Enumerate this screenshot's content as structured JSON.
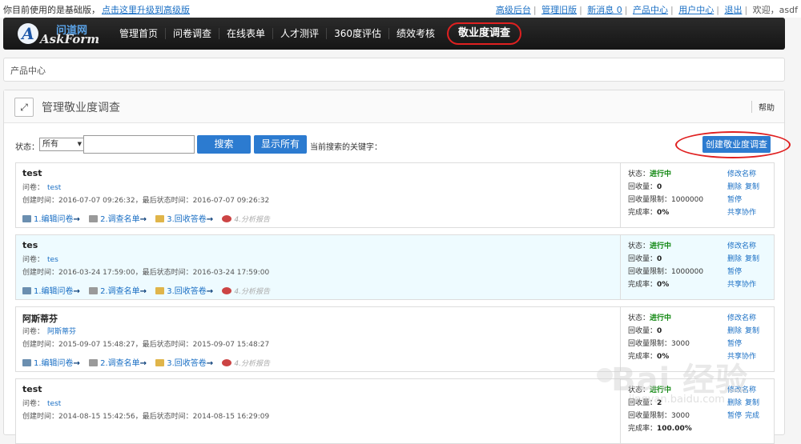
{
  "topbar": {
    "version_text": "你目前使用的是基础版，",
    "upgrade_link": "点击这里升级到高级版",
    "links": [
      "高级后台",
      "管理旧版",
      "新消息 0",
      "产品中心",
      "用户中心",
      "退出"
    ],
    "welcome": "欢迎，asdf"
  },
  "logo": {
    "cn": "问道网",
    "en": "AskForm",
    "letter": "A"
  },
  "nav": {
    "items": [
      "管理首页",
      "问卷调查",
      "在线表单",
      "人才测评",
      "360度评估",
      "绩效考核"
    ],
    "active": "敬业度调查"
  },
  "breadcrumb": "产品中心",
  "panel": {
    "title": "管理敬业度调查",
    "help": "帮助"
  },
  "filter": {
    "status_label": "状态：",
    "status_value": "所有",
    "search_btn": "搜索",
    "show_all_btn": "显示所有",
    "current_keyword_label": "当前搜索的关键字：",
    "create_btn": "创建敬业度调查"
  },
  "labels": {
    "questionnaire": "问卷：",
    "status": "状态：",
    "responses": "回收量：",
    "limit": "回收量限制：",
    "completion": "完成率：",
    "created": "创建时间：",
    "last_status": "，最后状态时间：",
    "step1": "1.编辑问卷",
    "step2": "2.调查名单",
    "step3": "3.回收答卷",
    "step4": "4.分析报告",
    "rename": "修改名称",
    "delete": "删除",
    "copy": "复制",
    "pause": "暂停",
    "share": "共享协作",
    "complete": "完成"
  },
  "surveys": [
    {
      "title": "test",
      "questionnaire": "test",
      "created": "2016-07-07 09:26:32",
      "last": "2016-07-07 09:26:32",
      "status": "进行中",
      "responses": "0",
      "limit": "1000000",
      "rate": "0%"
    },
    {
      "title": "tes",
      "questionnaire": "tes",
      "created": "2016-03-24 17:59:00",
      "last": "2016-03-24 17:59:00",
      "status": "进行中",
      "responses": "0",
      "limit": "1000000",
      "rate": "0%"
    },
    {
      "title": "阿斯蒂芬",
      "questionnaire": "阿斯蒂芬",
      "created": "2015-09-07 15:48:27",
      "last": "2015-09-07 15:48:27",
      "status": "进行中",
      "responses": "0",
      "limit": "3000",
      "rate": "0%"
    },
    {
      "title": "test",
      "questionnaire": "test",
      "created": "2014-08-15 15:42:56",
      "last": "2014-08-15 16:29:09",
      "status": "进行中",
      "responses": "2",
      "limit": "3000",
      "rate": "100.00%"
    }
  ],
  "watermark": {
    "big": "Bai 经验",
    "small": "jingyan.baidu.com"
  }
}
